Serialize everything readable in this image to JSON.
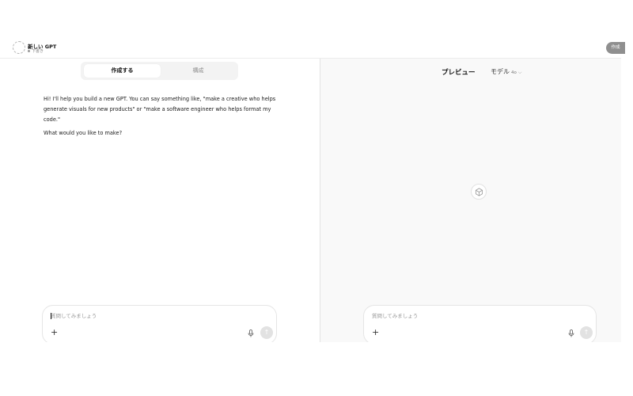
{
  "header": {
    "gpt_name": "新しい GPT",
    "status": "下書き",
    "create_button_label": "作成"
  },
  "tabs": [
    {
      "label": "作成する",
      "active": true
    },
    {
      "label": "構成",
      "active": false
    }
  ],
  "conversation": {
    "messages": [
      "Hi! I'll help you build a new GPT. You can say something like, \"make a creative who helps generate visuals for new products\" or \"make a software engineer who helps format my code.\"",
      "What would you like to make?"
    ]
  },
  "preview": {
    "title": "プレビュー",
    "model_label": "モデル",
    "model_version": "4o",
    "placeholder_icon": "cube-icon"
  },
  "composer": {
    "placeholder": "質問してみましょう"
  },
  "icons": {
    "add": "plus-icon",
    "mic": "microphone-icon",
    "send": "arrow-up-icon"
  }
}
